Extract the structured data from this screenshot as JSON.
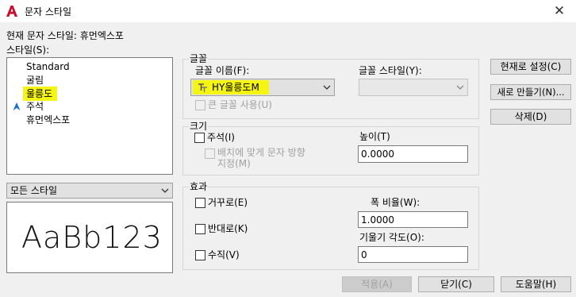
{
  "window": {
    "title": "문자 스타일",
    "close_glyph": "✕"
  },
  "current_style": "현재 문자 스타일: 휴먼엑스포",
  "styles_label": "스타일(S):",
  "styles_list": [
    "Standard",
    "굴림",
    "울릉도",
    "주석",
    "휴먼엑스포"
  ],
  "selected_style": "울릉도",
  "filter_select": "모든 스타일",
  "preview_text": "AaBb123",
  "font_group": {
    "title": "글꼴",
    "name_label": "글꼴 이름(F):",
    "name_value": "HY울릉도M",
    "style_label": "글꼴 스타일(Y):",
    "style_value": "",
    "bigfont_label": "큰 글꼴 사용(U)"
  },
  "size_group": {
    "title": "크기",
    "annotative_label": "주석(I)",
    "match_orientation_label_1": "배치에 맞게 문자 방향",
    "match_orientation_label_2": "지정(M)",
    "height_label": "높이(T)",
    "height_value": "0.0000"
  },
  "effects_group": {
    "title": "효과",
    "upside_down_label": "거꾸로(E)",
    "backwards_label": "반대로(K)",
    "vertical_label": "수직(V)",
    "width_factor_label": "폭 비율(W):",
    "width_factor_value": "1.0000",
    "oblique_label": "기울기 각도(O):",
    "oblique_value": "0"
  },
  "buttons": {
    "set_current": "현재로 설정(C)",
    "new": "새로 만들기(N)...",
    "delete": "삭제(D)",
    "apply": "적용(A)",
    "close": "닫기(C)",
    "help": "도움말(H)"
  },
  "colors": {
    "highlight": "#f5f514",
    "app_icon": "#c8102e",
    "annotative_icon": "#1e6fd0"
  },
  "icons": {
    "app": "autocad-a-icon",
    "annotative": "annotative-scale-icon",
    "truetype": "truetype-font-icon",
    "dropdown": "chevron-down-icon"
  }
}
